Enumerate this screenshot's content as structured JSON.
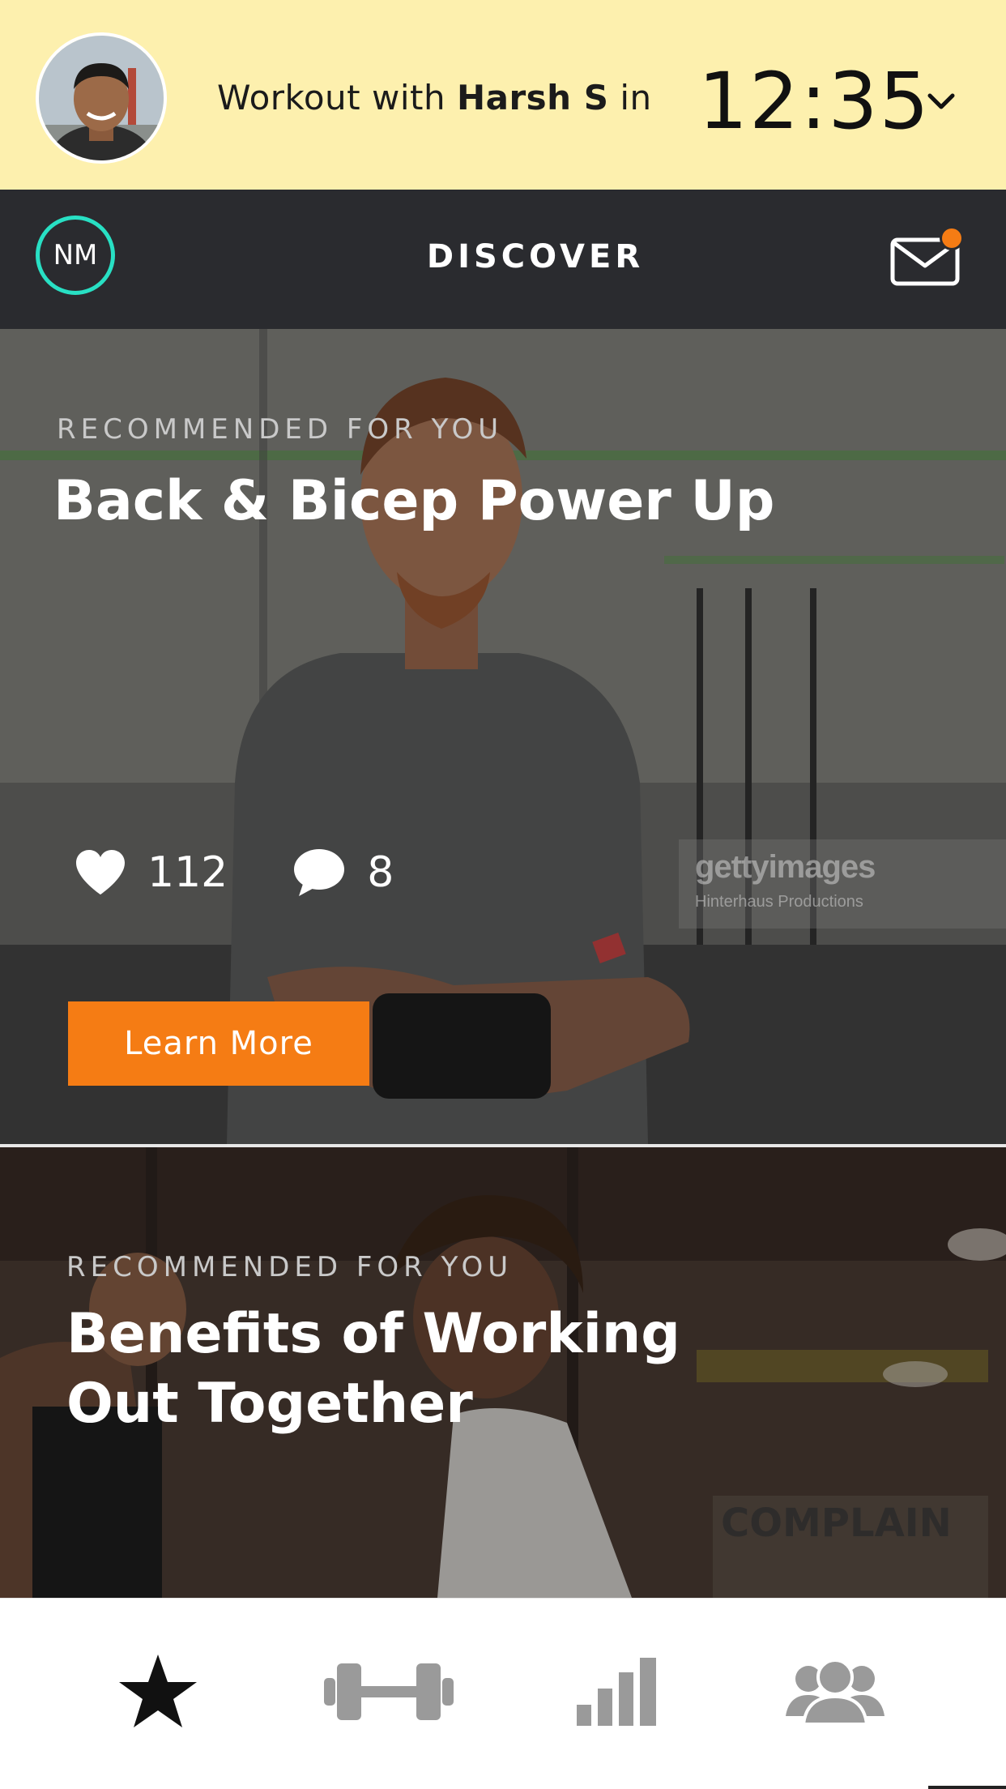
{
  "banner": {
    "prefix": "Workout with",
    "partner_name": "Harsh S",
    "suffix": "in",
    "timer": "12:35",
    "avatar_icon": "user-avatar",
    "chevron_icon": "chevron-down-icon",
    "background_color": "#fdf0ae"
  },
  "navbar": {
    "user_initials": "NM",
    "title": "DISCOVER",
    "mail_icon": "mail-icon",
    "has_notification": true,
    "accent_color": "#28e0c4",
    "notification_color": "#f57c14"
  },
  "cards": [
    {
      "eyebrow": "RECOMMENDED FOR YOU",
      "title": "Back & Bicep Power Up",
      "likes": "112",
      "comments": "8",
      "button_label": "Learn More",
      "watermark_brand": "gettyimages",
      "watermark_credit": "Hinterhaus Productions"
    },
    {
      "eyebrow": "RECOMMENDED FOR YOU",
      "title_line1": "Benefits of Working",
      "title_line2": "Out Together"
    }
  ],
  "tabbar": {
    "items": [
      {
        "icon": "star-icon",
        "active": true
      },
      {
        "icon": "dumbbell-icon",
        "active": false
      },
      {
        "icon": "bar-chart-icon",
        "active": false
      },
      {
        "icon": "group-icon",
        "active": false
      }
    ],
    "active_color": "#111111",
    "inactive_color": "#9a9a9a"
  }
}
